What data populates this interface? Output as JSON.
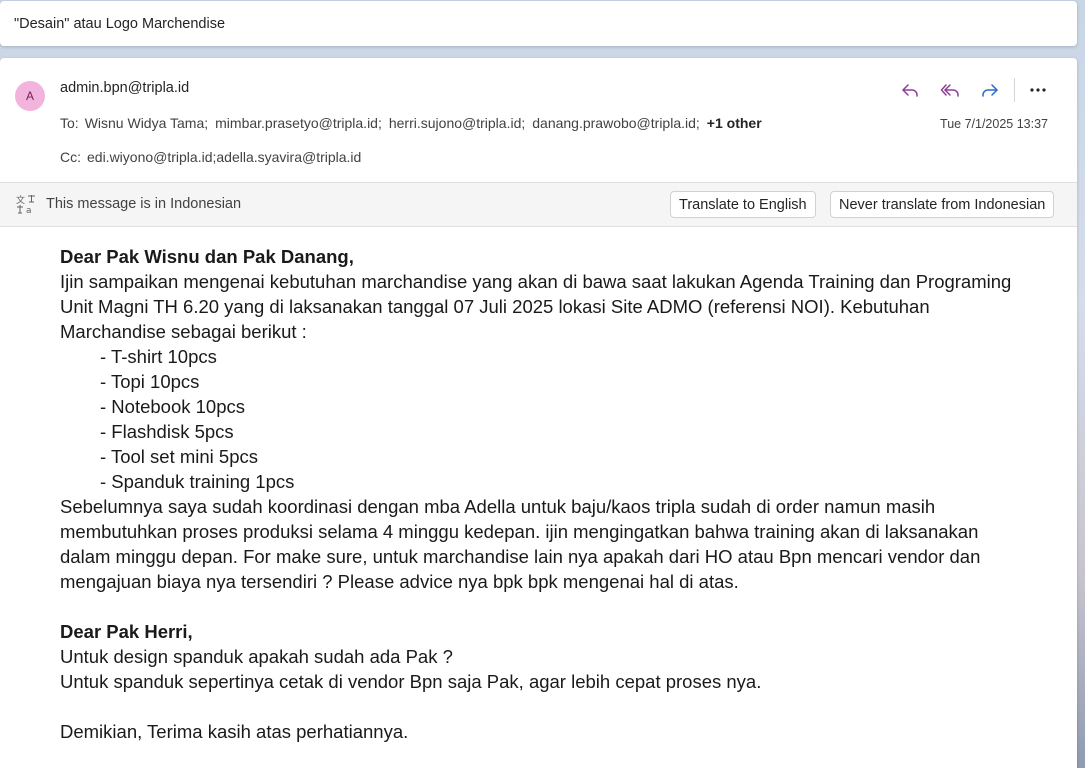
{
  "subject": "\"Desain\" atau Logo Marchendise",
  "sender": {
    "avatar_letter": "A",
    "email": "admin.bpn@tripla.id"
  },
  "actions": {
    "reply": "reply-icon",
    "reply_all": "reply-all-icon",
    "forward": "forward-icon",
    "more": "more-icon"
  },
  "to": {
    "label": "To:",
    "recipients": [
      "Wisnu Widya Tama;",
      "mimbar.prasetyo@tripla.id;",
      "herri.sujono@tripla.id;",
      "danang.prawobo@tripla.id;"
    ],
    "more": "+1 other"
  },
  "date": "Tue 7/1/2025 13:37",
  "cc": {
    "label": "Cc:",
    "recipients": [
      "edi.wiyono@tripla.id;",
      "adella.syavira@tripla.id"
    ]
  },
  "translate": {
    "message": "This message is in Indonesian",
    "translate_button": "Translate to English",
    "never_button": "Never translate from Indonesian"
  },
  "body": {
    "greeting1": "Dear Pak Wisnu dan Pak Danang,",
    "p1_line1": "Ijin sampaikan mengenai kebutuhan marchandise yang akan di bawa saat lakukan Agenda Training dan Programing",
    "p1_line2": "Unit Magni TH 6.20 yang di laksanakan tanggal 07 Juli 2025 lokasi Site ADMO (referensi NOI). Kebutuhan",
    "p1_line3": "Marchandise sebagai berikut :",
    "items": [
      "- T-shirt 10pcs",
      "- Topi 10pcs",
      "- Notebook 10pcs",
      "- Flashdisk 5pcs",
      "- Tool set mini 5pcs",
      "- Spanduk training 1pcs"
    ],
    "p2_line1": "Sebelumnya saya sudah koordinasi dengan mba Adella untuk baju/kaos tripla sudah di order namun masih",
    "p2_line2": "membutuhkan proses produksi selama 4 minggu kedepan. ijin mengingatkan bahwa training akan di laksanakan",
    "p2_line3": "dalam minggu depan. For make sure, untuk marchandise lain nya apakah dari HO atau Bpn mencari vendor dan",
    "p2_line4": "mengajuan biaya nya tersendiri ?  Please advice nya bpk bpk mengenai hal di atas.",
    "greeting2": "Dear Pak Herri,",
    "p3_line1": "Untuk design spanduk apakah sudah ada Pak ?",
    "p3_line2": "Untuk spanduk sepertinya cetak di vendor Bpn saja Pak, agar lebih cepat proses nya.",
    "closing": "Demikian, Terima kasih atas perhatiannya."
  }
}
